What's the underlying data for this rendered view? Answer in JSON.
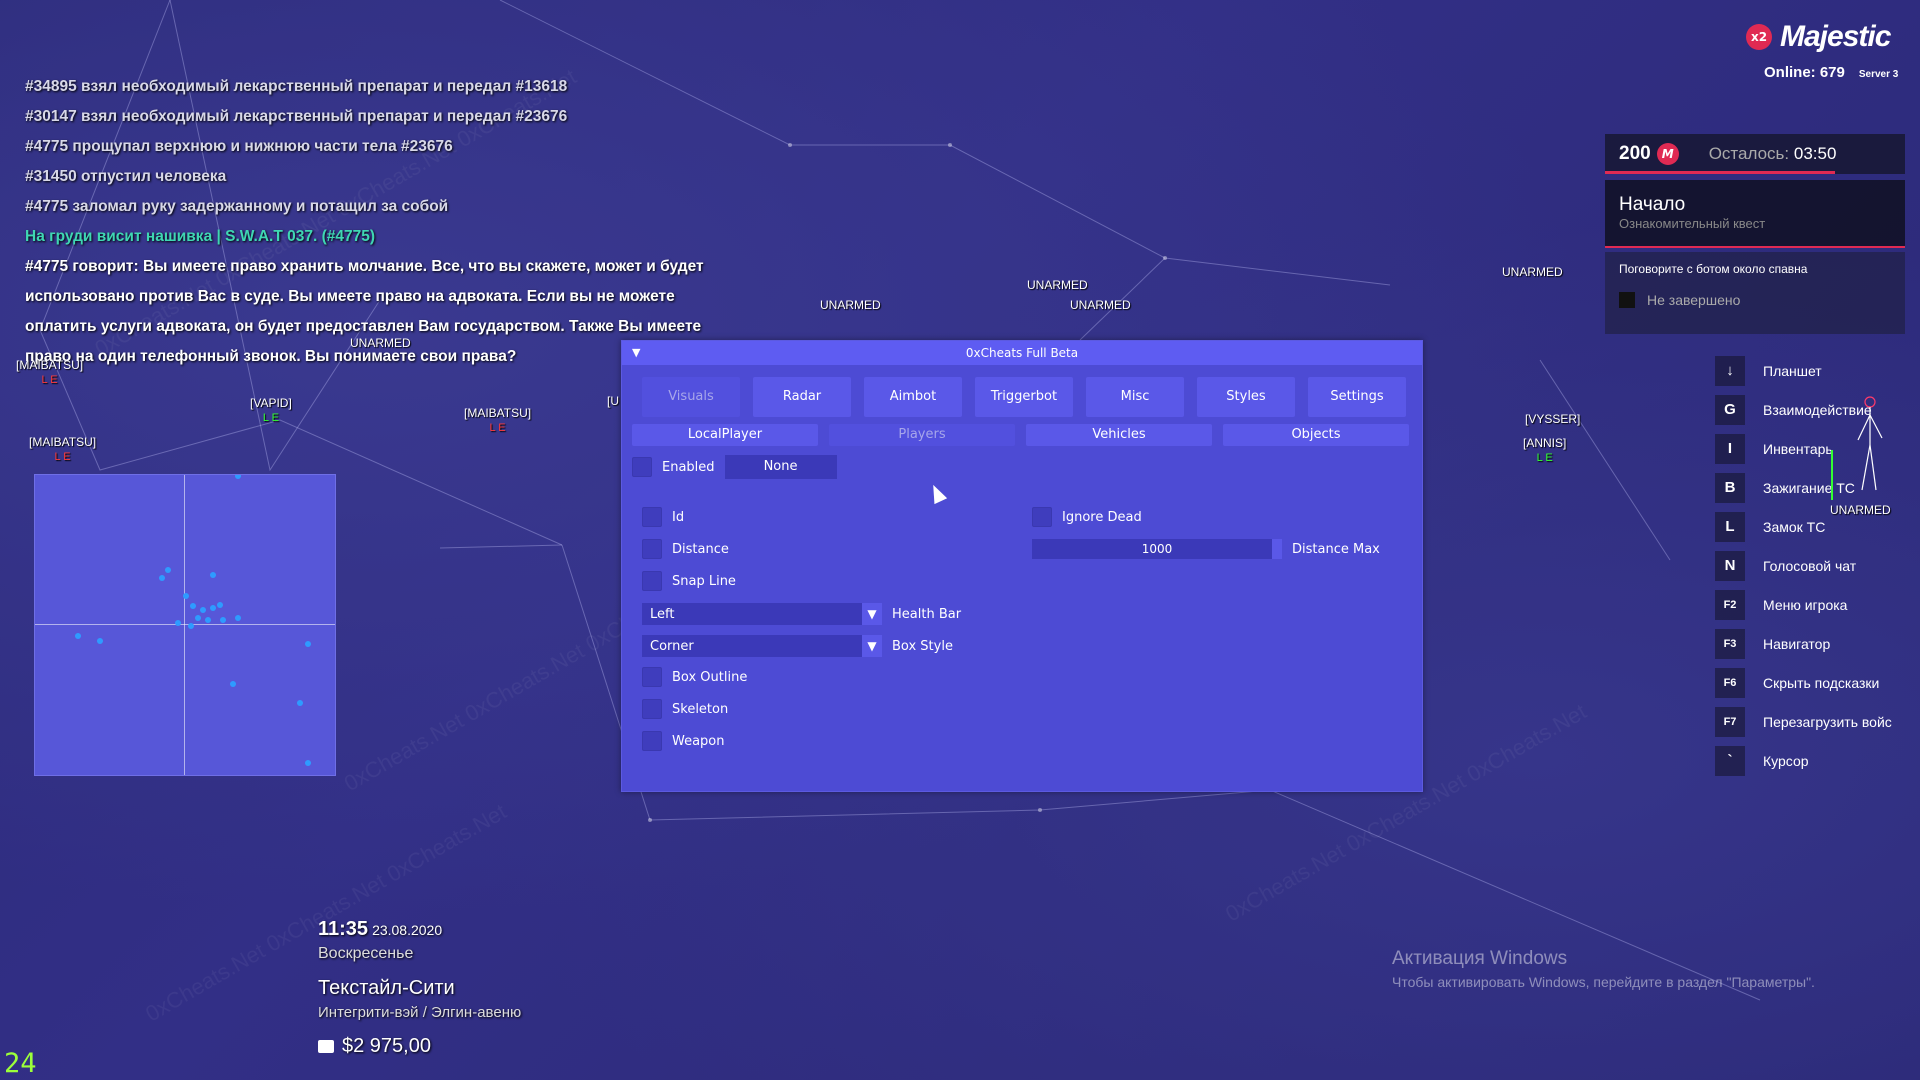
{
  "chat": {
    "lines": [
      "#34895 взял необходимый лекарственный препарат и передал #13618",
      "#30147 взял необходимый лекарственный препарат и передал #23676",
      "#4775 прощупал верхнюю и нижнюю части тела #23676",
      "#31450 отпустил человека",
      "#4775 заломал руку задержанному и потащил за собой"
    ],
    "teal_line": "На груди висит нашивка | S.W.A.T 037. (#4775)",
    "speech": "#4775 говорит: Вы имеете право хранить молчание. Все, что вы скажете, может и будет использовано против Вас в суде. Вы имеете право на адвоката. Если вы не можете оплатить услуги адвоката, он будет предоставлен Вам государством. Также Вы имеете право на один телефонный звонок. Вы понимаете свои права?"
  },
  "esp": {
    "unarmed": "UNARMED",
    "maibatsu": "[MAIBATSU]",
    "vapid": "[VAPID]",
    "vysser": "[VYSSER]",
    "annis": "[ANNIS]",
    "le": "L E",
    "u": "[U"
  },
  "menu": {
    "title": "0xCheats Full Beta",
    "tabs": [
      "Visuals",
      "Radar",
      "Aimbot",
      "Triggerbot",
      "Misc",
      "Styles",
      "Settings"
    ],
    "subtabs": [
      "LocalPlayer",
      "Players",
      "Vehicles",
      "Objects"
    ],
    "enabled_label": "Enabled",
    "none_button": "None",
    "id_label": "Id",
    "distance_label": "Distance",
    "snapline_label": "Snap Line",
    "healthbar_value": "Left",
    "healthbar_label": "Health Bar",
    "boxstyle_value": "Corner",
    "boxstyle_label": "Box Style",
    "boxoutline_label": "Box Outline",
    "skeleton_label": "Skeleton",
    "weapon_label": "Weapon",
    "ignoredead_label": "Ignore Dead",
    "distance_max_value": "1000",
    "distance_max_label": "Distance Max"
  },
  "hud": {
    "badge": "x2",
    "brand": "Majestic",
    "online": "Online: 679",
    "server": "Server 3",
    "points": "200",
    "points_icon": "M",
    "left_label": "Осталось:",
    "left_time": "03:50",
    "quest_title": "Начало",
    "quest_sub": "Ознакомительный квест",
    "quest_task": "Поговорите с ботом около спавна",
    "quest_status": "Не завершено"
  },
  "keys": [
    {
      "key": "↓",
      "label": "Планшет"
    },
    {
      "key": "G",
      "label": "Взаимодействие"
    },
    {
      "key": "I",
      "label": "Инвентарь"
    },
    {
      "key": "B",
      "label": "Зажигание ТС"
    },
    {
      "key": "L",
      "label": "Замок ТС"
    },
    {
      "key": "N",
      "label": "Голосовой чат"
    },
    {
      "key": "F2",
      "label": "Меню игрока"
    },
    {
      "key": "F3",
      "label": "Навигатор"
    },
    {
      "key": "F6",
      "label": "Скрыть подсказки"
    },
    {
      "key": "F7",
      "label": "Перезагрузить войс"
    },
    {
      "key": "`",
      "label": "Курсор"
    }
  ],
  "info": {
    "time": "11:35",
    "date": "23.08.2020",
    "day": "Воскресенье",
    "city": "Текстайл-Сити",
    "street": "Интегрити-вэй / Элгин-авеню",
    "money": "$2 975,00"
  },
  "fps": "24",
  "windows": {
    "title": "Активация Windows",
    "text": "Чтобы активировать Windows, перейдите в раздел \"Параметры\"."
  },
  "colors": {
    "accent": "#e02a53",
    "menu_bg": "#4d4bd4",
    "teal": "#3fd7b3",
    "fps": "#9cff3a"
  }
}
